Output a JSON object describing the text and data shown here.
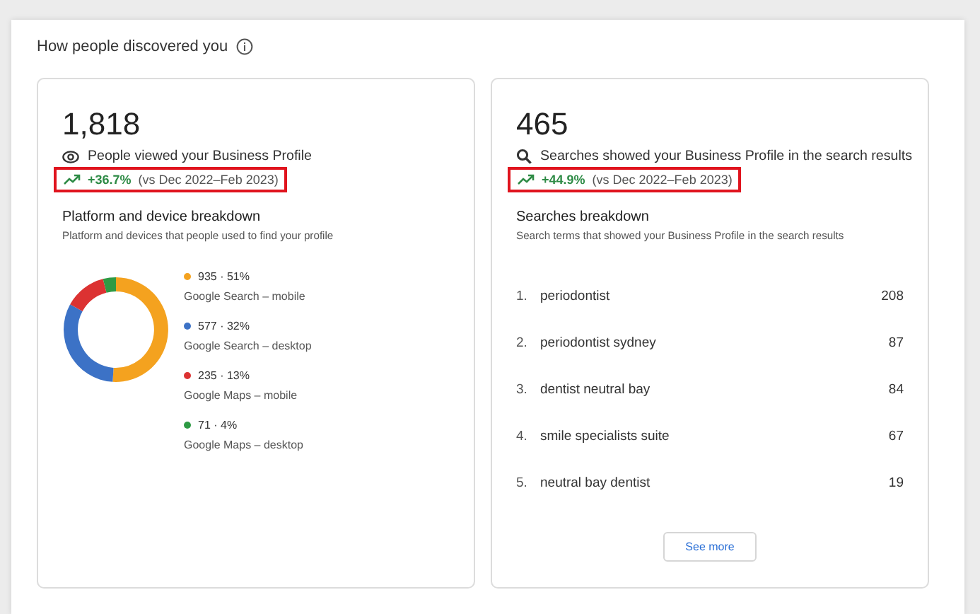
{
  "section": {
    "title": "How people discovered you"
  },
  "cards": [
    {
      "kind": "views",
      "total": "1,818",
      "metric": "People viewed your Business Profile",
      "change": {
        "value": "+36.7%",
        "period": "(vs Dec 2022–Feb 2023)",
        "highlighted": true
      },
      "breakdown": {
        "kind": "donut",
        "title": "Platform and device breakdown",
        "subtitle": "Platform and devices that people used to find your profile",
        "items": [
          {
            "value": "935 · 51%",
            "color": "#f4a21f"
          },
          {
            "value": "577 · 32%",
            "color": "#3c72c6"
          },
          {
            "value": "235 · 13%",
            "color": "#dc3232"
          },
          {
            "value": "71 · 4%",
            "color": "#2e9a44"
          }
        ],
        "chart_data": {
          "type": "donut",
          "categories": [
            "Google Search – mobile",
            "Google Search – desktop",
            "Google Maps – mobile",
            "Google Maps – desktop"
          ],
          "values": [
            51,
            32,
            13,
            4
          ]
        }
      }
    },
    {
      "kind": "searches",
      "total": "465",
      "metric": "Searches showed your Business Profile in the search results",
      "change": {
        "value": "+44.9%",
        "period": "(vs Dec 2022–Feb 2023)",
        "highlighted": true
      },
      "breakdown": {
        "kind": "list",
        "title": "Searches breakdown",
        "subtitle": "Search terms that showed your Business Profile in the search results",
        "rows": [
          {
            "rank": "1.",
            "term": "periodontist",
            "count": "208"
          },
          {
            "rank": "2.",
            "term": "periodontist sydney",
            "count": "87"
          },
          {
            "rank": "3.",
            "term": "dentist neutral bay",
            "count": "84"
          },
          {
            "rank": "4.",
            "term": "smile specialists suite",
            "count": "67"
          },
          {
            "rank": "5.",
            "term": "neutral bay dentist",
            "count": "19"
          }
        ],
        "button": "See more"
      }
    }
  ]
}
